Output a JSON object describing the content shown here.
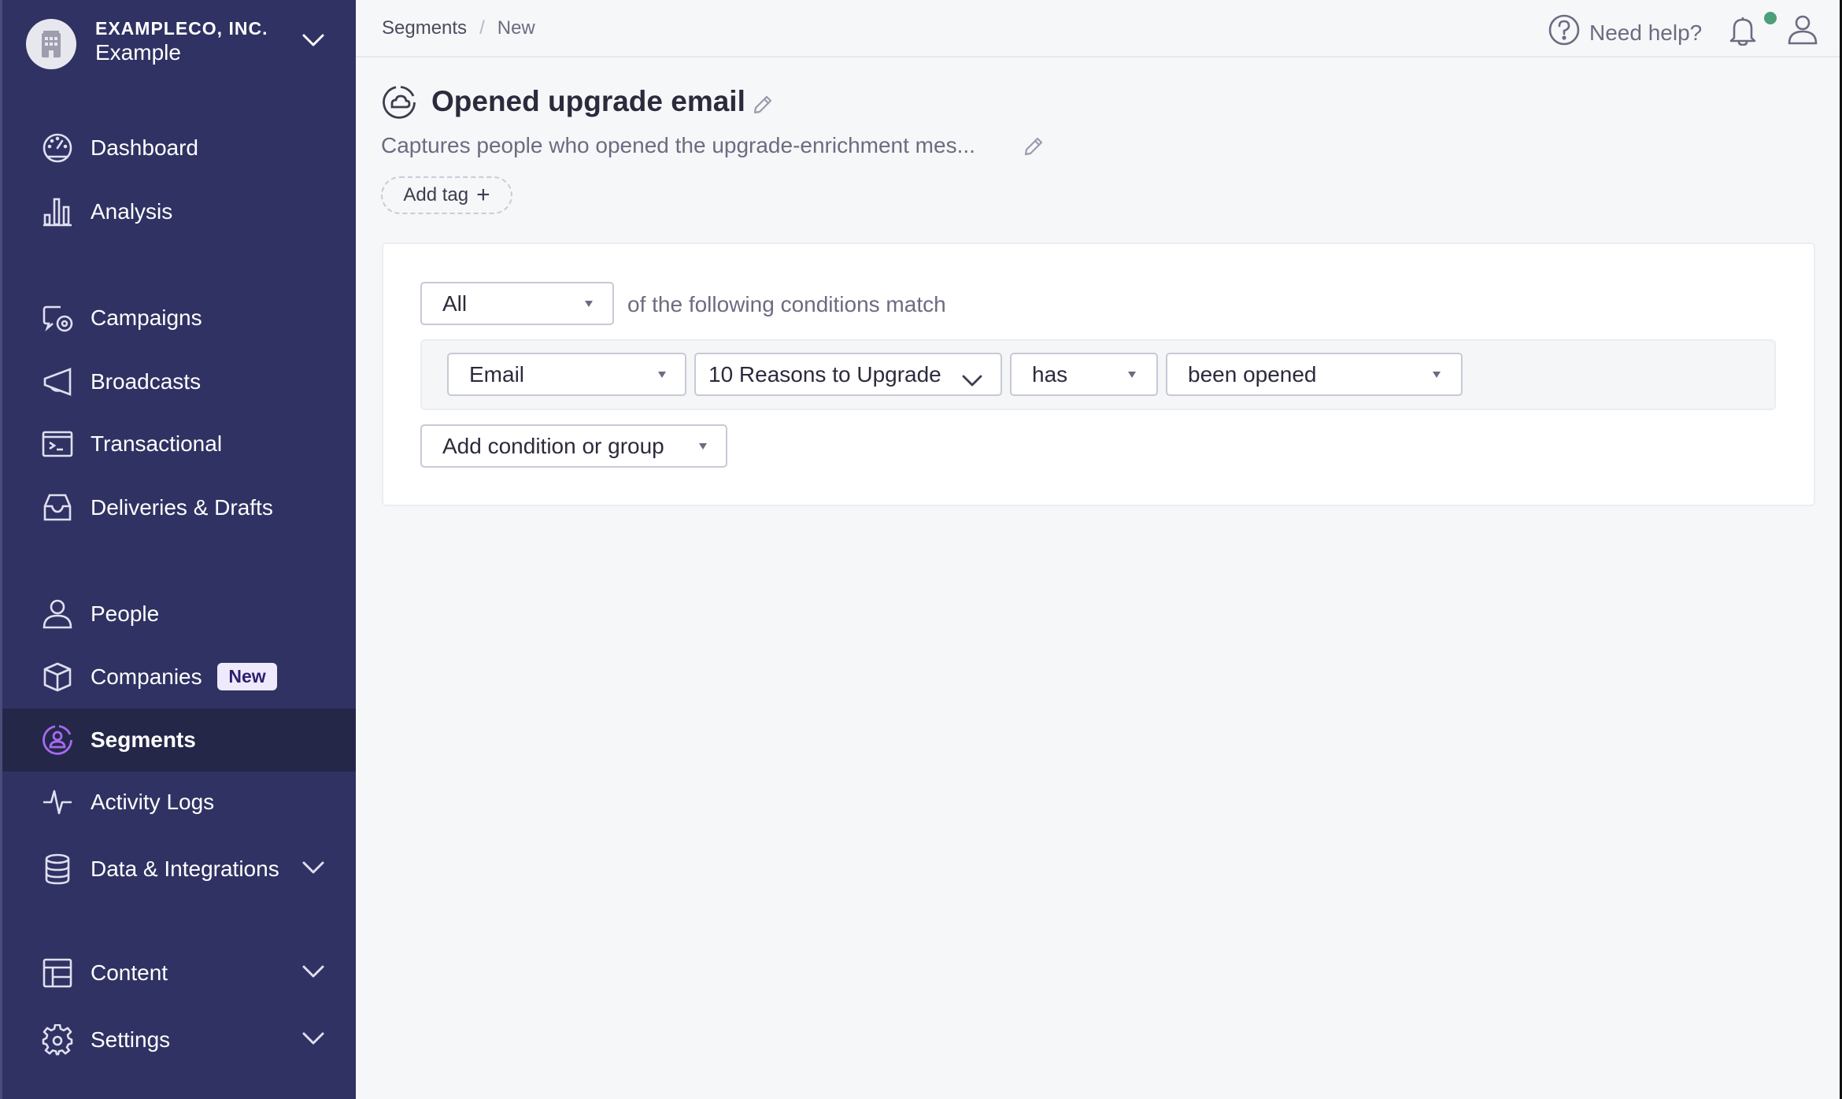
{
  "org": {
    "name": "EXAMPLECO, INC.",
    "workspace": "Example"
  },
  "sidebar": {
    "items": [
      {
        "label": "Dashboard",
        "icon": "dashboard-gauge-icon"
      },
      {
        "label": "Analysis",
        "icon": "bar-chart-icon"
      },
      {
        "label": "Campaigns",
        "icon": "campaigns-icon"
      },
      {
        "label": "Broadcasts",
        "icon": "megaphone-icon"
      },
      {
        "label": "Transactional",
        "icon": "terminal-icon"
      },
      {
        "label": "Deliveries & Drafts",
        "icon": "inbox-tray-icon"
      },
      {
        "label": "People",
        "icon": "person-icon"
      },
      {
        "label": "Companies",
        "icon": "cube-icon",
        "badge": "New"
      },
      {
        "label": "Segments",
        "icon": "segment-icon",
        "active": true
      },
      {
        "label": "Activity Logs",
        "icon": "pulse-icon"
      },
      {
        "label": "Data & Integrations",
        "icon": "database-icon",
        "expandable": true
      },
      {
        "label": "Content",
        "icon": "layout-icon",
        "expandable": true
      },
      {
        "label": "Settings",
        "icon": "gear-icon",
        "expandable": true
      }
    ]
  },
  "header": {
    "breadcrumb": [
      "Segments",
      "New"
    ],
    "breadcrumb_separator": "/",
    "help_label": "Need help?",
    "notification_dot_color": "#4D9E7B"
  },
  "segment": {
    "title": "Opened upgrade email",
    "description": "Captures people who opened the upgrade-enrichment mes...",
    "add_tag_label": "Add tag",
    "add_tag_icon": "+"
  },
  "conditions": {
    "match_mode": "All",
    "match_text": "of the following conditions match",
    "rows": [
      {
        "type": "Email",
        "message": "10 Reasons to Upgrade",
        "operator": "has",
        "action": "been opened"
      }
    ],
    "add_label": "Add condition or group"
  },
  "colors": {
    "sidebar_bg": "#303263",
    "sidebar_active_bg": "#252749",
    "active_icon": "#A56BF0",
    "badge_bg": "#EEEAFB",
    "badge_text": "#2D1F6E"
  }
}
